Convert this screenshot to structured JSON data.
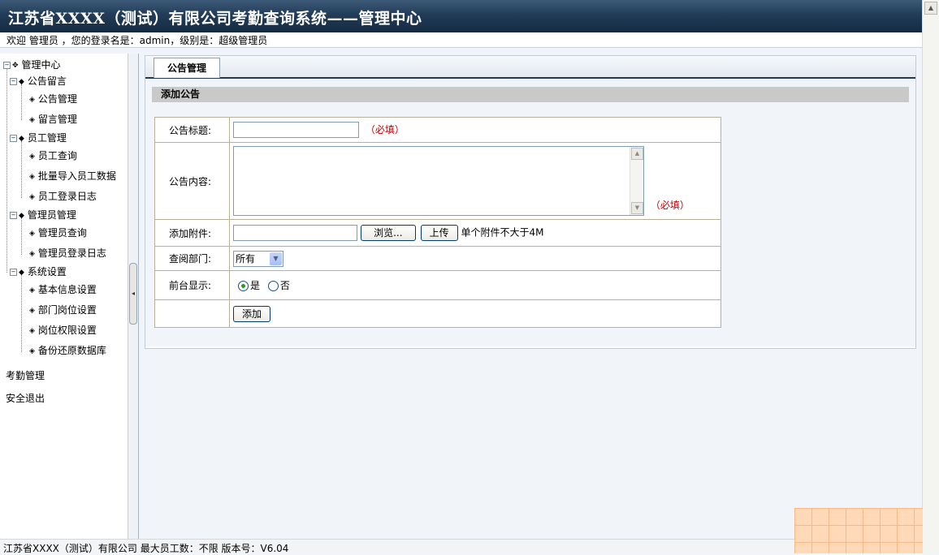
{
  "header": {
    "title": "江苏省XXXX（测试）有限公司考勤查询系统——管理中心",
    "welcome": "欢迎 管理员 ，您的登录名是：admin，级别是：超级管理员"
  },
  "sidebar": {
    "root": "管理中心",
    "groups": [
      {
        "label": "公告留言",
        "items": [
          "公告管理",
          "留言管理"
        ]
      },
      {
        "label": "员工管理",
        "items": [
          "员工查询",
          "批量导入员工数据",
          "员工登录日志"
        ]
      },
      {
        "label": "管理员管理",
        "items": [
          "管理员查询",
          "管理员登录日志"
        ]
      },
      {
        "label": "系统设置",
        "items": [
          "基本信息设置",
          "部门岗位设置",
          "岗位权限设置",
          "备份还原数据库"
        ]
      }
    ],
    "links": [
      "考勤管理",
      "安全退出"
    ]
  },
  "tab": {
    "label": "公告管理"
  },
  "section": {
    "title": "添加公告"
  },
  "form": {
    "title_label": "公告标题:",
    "content_label": "公告内容:",
    "required": "（必填）",
    "attach_label": "添加附件:",
    "browse_button": "浏览...",
    "upload_button": "上传",
    "attach_hint": "单个附件不大于4M",
    "dept_label": "查阅部门:",
    "dept_value": "所有",
    "display_label": "前台显示:",
    "yes": "是",
    "no": "否",
    "submit_button": "添加"
  },
  "footer": {
    "text": "江苏省XXXX（测试）有限公司  最大员工数：不限  版本号：V6.04"
  }
}
